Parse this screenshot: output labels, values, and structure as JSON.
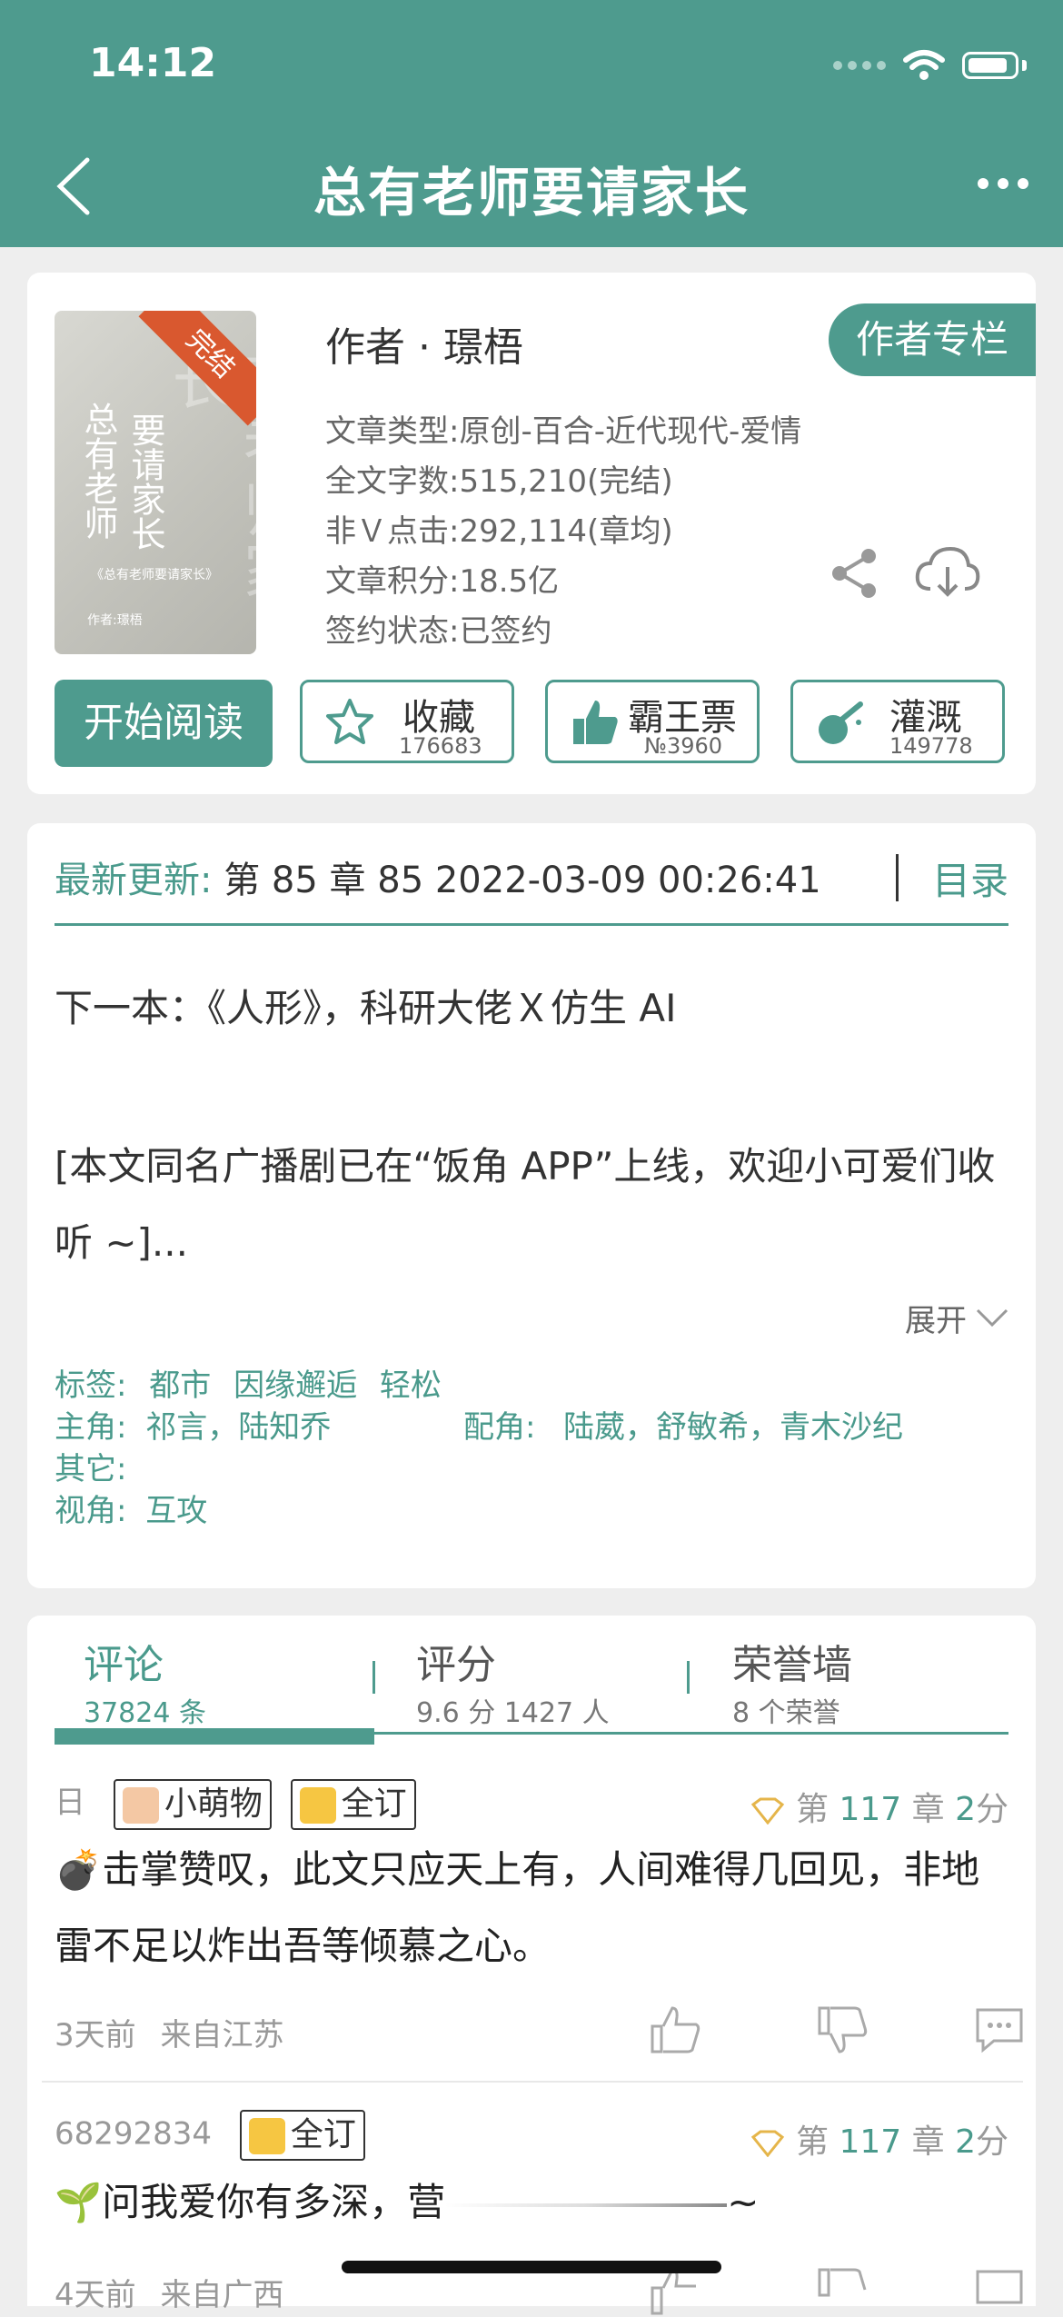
{
  "status": {
    "time": "14:12"
  },
  "header": {
    "title": "总有老师要请家长"
  },
  "book": {
    "cover_title_a": "总有老师",
    "cover_title_b": "要请家长",
    "cover_bg": "有老师家长",
    "cover_sub": "《总有老师要请家长》",
    "cover_author": "作者:璟梧",
    "ribbon": "完结",
    "author": "作者 · 璟梧",
    "author_column": "作者专栏",
    "meta": [
      "文章类型:原创-百合-近代现代-爱情",
      "全文字数:515,210(完结)",
      "非Ｖ点击:292,114(章均)",
      "文章积分:18.5亿",
      "签约状态:已签约"
    ],
    "read_button": "开始阅读",
    "actions": [
      {
        "label": "收藏",
        "count": "176683",
        "icon": "star-icon"
      },
      {
        "label": "霸王票",
        "count": "№3960",
        "icon": "thumb-up-icon"
      },
      {
        "label": "灌溉",
        "count": "149778",
        "icon": "watering-icon"
      }
    ]
  },
  "update": {
    "label": "最新更新:",
    "text": "第 85 章 85 2022-03-09 00:26:41",
    "toc": "目录"
  },
  "desc": {
    "line1": "下一本：《人形》，科研大佬Ｘ仿生 AI",
    "line2": "[本文同名广播剧已在“饭角 APP”上线，欢迎小可爱们收听 ~]...",
    "expand": "展开"
  },
  "tags": {
    "tags_label": "标签:",
    "tags": [
      "都市",
      "因缘邂逅",
      "轻松"
    ],
    "lead_label": "主角:",
    "lead": "祁言，陆知乔",
    "support_label": "配角:",
    "support": "陆葳，舒敏希，青木沙纪",
    "other_label": "其它:",
    "other": "",
    "view_label": "视角:",
    "view": "互攻"
  },
  "tabs": [
    {
      "title": "评论",
      "sub": "37824 条"
    },
    {
      "title": "评分",
      "sub": "9.6 分 1427 人"
    },
    {
      "title": "荣誉墙",
      "sub": "8 个荣誉"
    }
  ],
  "comments": [
    {
      "user": "日",
      "badges": [
        "小萌物",
        "全订"
      ],
      "chapter_prefix": "第",
      "chapter_num": "117",
      "chapter_suffix": "章",
      "score_num": "2",
      "score_suffix": "分",
      "text": "💣击掌赞叹，此文只应天上有，人间难得几回见，非地雷不足以炸出吾等倾慕之心。",
      "time": "3天前",
      "from": "来自江苏"
    },
    {
      "user": "68292834",
      "badges": [
        "全订"
      ],
      "chapter_prefix": "第",
      "chapter_num": "117",
      "chapter_suffix": "章",
      "score_num": "2",
      "score_suffix": "分",
      "text": "🌱问我爱你有多深，营",
      "text_tail": "~",
      "time": "4天前",
      "from": "来自广西"
    }
  ],
  "colors": {
    "accent": "#4e9b8e",
    "ribbon": "#d9582f"
  }
}
